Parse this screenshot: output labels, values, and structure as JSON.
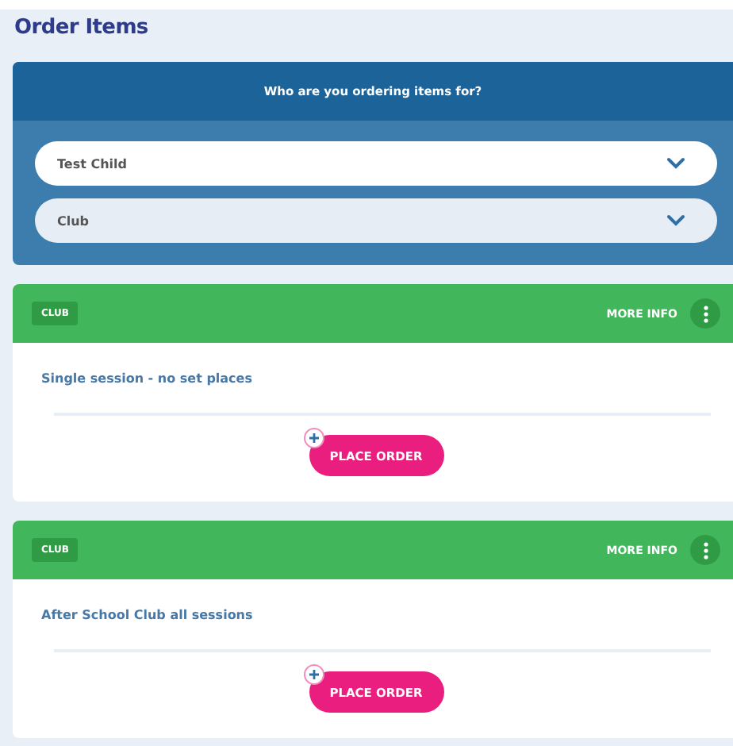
{
  "page": {
    "title": "Order Items"
  },
  "selector": {
    "heading": "Who are you ordering items for?",
    "dropdowns": [
      {
        "value": "Test Child"
      },
      {
        "value": "Club"
      }
    ]
  },
  "items": [
    {
      "tag": "CLUB",
      "more_info": "MORE INFO",
      "name": "Single session - no set places",
      "button": "PLACE ORDER"
    },
    {
      "tag": "CLUB",
      "more_info": "MORE INFO",
      "name": "After School Club all sessions",
      "button": "PLACE ORDER"
    }
  ]
}
